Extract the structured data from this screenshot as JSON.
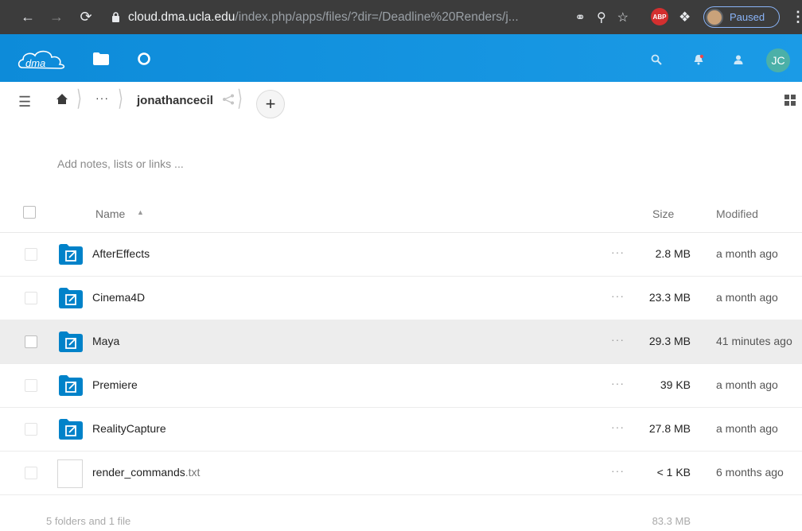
{
  "browser": {
    "url_host": "cloud.dma.ucla.edu",
    "url_path": "/index.php/apps/files/?dir=/Deadline%20Renders/j...",
    "paused_label": "Paused",
    "abp_label": "ABP"
  },
  "header": {
    "avatar_initials": "JC"
  },
  "breadcrumb": {
    "ellipsis": "···",
    "current": "jonathancecil"
  },
  "notes_placeholder": "Add notes, lists or links ...",
  "table": {
    "col_name": "Name",
    "col_size": "Size",
    "col_modified": "Modified",
    "rows": [
      {
        "name": "AfterEffects",
        "ext": "",
        "type": "shared-folder",
        "size": "2.8 MB",
        "modified": "a month ago"
      },
      {
        "name": "Cinema4D",
        "ext": "",
        "type": "shared-folder",
        "size": "23.3 MB",
        "modified": "a month ago"
      },
      {
        "name": "Maya",
        "ext": "",
        "type": "shared-folder",
        "size": "29.3 MB",
        "modified": "41 minutes ago",
        "highlighted": true
      },
      {
        "name": "Premiere",
        "ext": "",
        "type": "shared-folder",
        "size": "39 KB",
        "modified": "a month ago"
      },
      {
        "name": "RealityCapture",
        "ext": "",
        "type": "shared-folder",
        "size": "27.8 MB",
        "modified": "a month ago"
      },
      {
        "name": "render_commands",
        "ext": ".txt",
        "type": "file",
        "size": "< 1 KB",
        "modified": "6 months ago"
      }
    ],
    "more_label": "···"
  },
  "summary": {
    "text": "5 folders and 1 file",
    "total_size": "83.3 MB"
  },
  "colors": {
    "header_blue": "#0d8bd9",
    "folder_blue": "#0082c9",
    "chrome_bg": "#3c3c3c"
  }
}
